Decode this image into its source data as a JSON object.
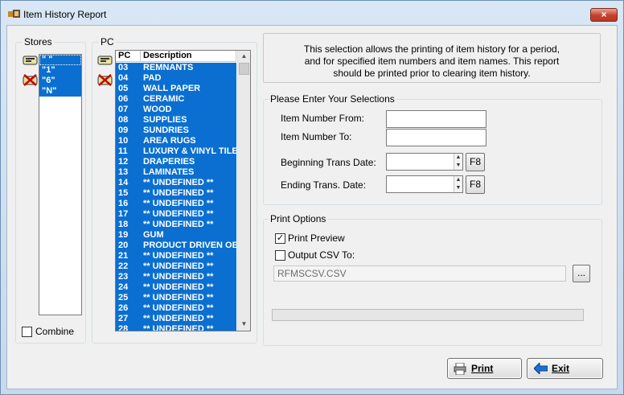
{
  "window": {
    "title": "Item History Report",
    "close_label": "×"
  },
  "stores": {
    "legend": "Stores",
    "items": [
      "\" \"",
      "\"1\"",
      "\"6\"",
      "\"N\""
    ],
    "combine_label": "Combine",
    "combine_checked": false
  },
  "pc": {
    "legend": "PC",
    "col_pc": "PC",
    "col_desc": "Description",
    "rows": [
      {
        "pc": "03",
        "desc": "REMNANTS"
      },
      {
        "pc": "04",
        "desc": "PAD"
      },
      {
        "pc": "05",
        "desc": "WALL PAPER"
      },
      {
        "pc": "06",
        "desc": "CERAMIC"
      },
      {
        "pc": "07",
        "desc": "WOOD"
      },
      {
        "pc": "08",
        "desc": "SUPPLIES"
      },
      {
        "pc": "09",
        "desc": "SUNDRIES"
      },
      {
        "pc": "10",
        "desc": "AREA RUGS"
      },
      {
        "pc": "11",
        "desc": "LUXURY & VINYL TILE"
      },
      {
        "pc": "12",
        "desc": "DRAPERIES"
      },
      {
        "pc": "13",
        "desc": "LAMINATES"
      },
      {
        "pc": "14",
        "desc": "** UNDEFINED **"
      },
      {
        "pc": "15",
        "desc": "** UNDEFINED **"
      },
      {
        "pc": "16",
        "desc": "** UNDEFINED **"
      },
      {
        "pc": "17",
        "desc": "** UNDEFINED **"
      },
      {
        "pc": "18",
        "desc": "** UNDEFINED **"
      },
      {
        "pc": "19",
        "desc": "GUM"
      },
      {
        "pc": "20",
        "desc": "PRODUCT DRIVEN OE"
      },
      {
        "pc": "21",
        "desc": "** UNDEFINED **"
      },
      {
        "pc": "22",
        "desc": "** UNDEFINED **"
      },
      {
        "pc": "23",
        "desc": "** UNDEFINED **"
      },
      {
        "pc": "24",
        "desc": "** UNDEFINED **"
      },
      {
        "pc": "25",
        "desc": "** UNDEFINED **"
      },
      {
        "pc": "26",
        "desc": "** UNDEFINED **"
      },
      {
        "pc": "27",
        "desc": "** UNDEFINED **"
      },
      {
        "pc": "28",
        "desc": "** UNDEFINED **"
      }
    ]
  },
  "info": {
    "line1": "This selection allows the printing of item history for a period,",
    "line2": "and for specified item numbers and item names.  This report",
    "line3": "should be printed prior to clearing item history."
  },
  "selections": {
    "legend": "Please Enter Your Selections",
    "item_from_label": "Item Number From:",
    "item_from_value": "",
    "item_to_label": "Item Number To:",
    "item_to_value": "",
    "begin_date_label": "Beginning Trans Date:",
    "begin_date_value": "",
    "end_date_label": "Ending Trans. Date:",
    "end_date_value": "",
    "f8_label": "F8"
  },
  "print_options": {
    "legend": "Print Options",
    "print_preview_label": "Print Preview",
    "print_preview_checked": true,
    "output_csv_label": "Output CSV To:",
    "output_csv_checked": false,
    "csv_path": "RFMSCSV.CSV",
    "browse_label": "...",
    "progress": 0
  },
  "buttons": {
    "print_label": "Print",
    "exit_label": "Exit"
  }
}
